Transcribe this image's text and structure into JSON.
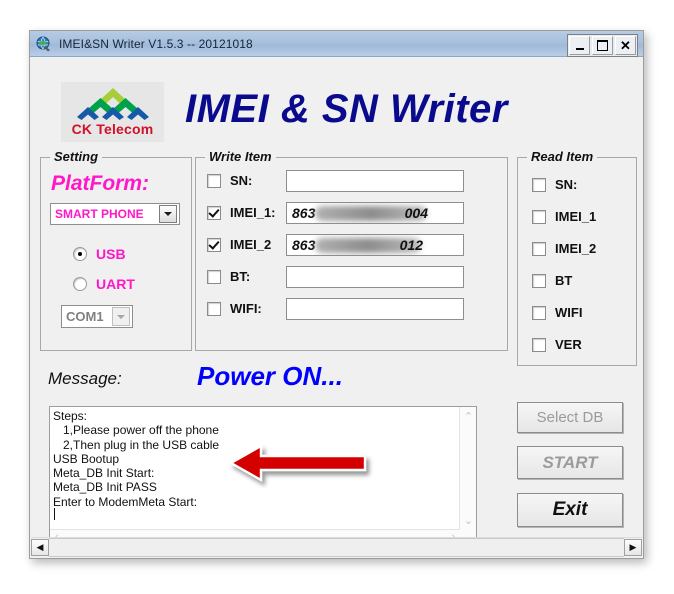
{
  "window": {
    "title": "IMEI&SN Writer V1.5.3 -- 20121018",
    "icon": "globe-icon",
    "minimize_label": "_",
    "maximize_label": "□",
    "close_label": "✕"
  },
  "header": {
    "logo_text": "CK Telecom",
    "app_title": "IMEI & SN Writer",
    "title_color": "#0a0a8c",
    "logo_color": "#d1102a"
  },
  "setting": {
    "group_title": "Setting",
    "platform_label": "PlatForm:",
    "platform_color": "#ff17c8",
    "platform_value": "SMART PHONE",
    "connection": [
      {
        "label": "USB",
        "selected": true
      },
      {
        "label": "UART",
        "selected": false
      }
    ],
    "port_value": "COM1",
    "port_enabled": false
  },
  "write_item": {
    "group_title": "Write Item",
    "rows": [
      {
        "label": "SN:",
        "checked": false,
        "value": "",
        "redacted": false
      },
      {
        "label": "IMEI_1:",
        "checked": true,
        "value": "863",
        "value_suffix": "004",
        "redacted": true
      },
      {
        "label": "IMEI_2",
        "checked": true,
        "value": "863",
        "value_suffix": "012",
        "redacted": true
      },
      {
        "label": "BT:",
        "checked": false,
        "value": "",
        "redacted": false
      },
      {
        "label": "WIFI:",
        "checked": false,
        "value": "",
        "redacted": false
      }
    ]
  },
  "read_item": {
    "group_title": "Read Item",
    "rows": [
      {
        "label": "SN:",
        "checked": false
      },
      {
        "label": "IMEI_1",
        "checked": false
      },
      {
        "label": "IMEI_2",
        "checked": false
      },
      {
        "label": "BT",
        "checked": false
      },
      {
        "label": "WIFI",
        "checked": false
      },
      {
        "label": "VER",
        "checked": false
      }
    ]
  },
  "message": {
    "label": "Message:",
    "status": "Power ON...",
    "status_color": "#0000ff",
    "log": "Steps:\n   1,Please power off the phone\n   2,Then plug in the USB cable\nUSB Bootup\nMeta_DB Init Start:\nMeta_DB Init PASS\nEnter to ModemMeta Start:",
    "scroll_up": "⌃",
    "scroll_down": "⌄",
    "scroll_left": "‹",
    "scroll_right": "›"
  },
  "annotation": {
    "arrow": "red-left-arrow",
    "arrow_color": "#d40000"
  },
  "buttons": {
    "select_db": {
      "label": "Select DB",
      "enabled": false
    },
    "start": {
      "label": "START",
      "enabled": false
    },
    "exit": {
      "label": "Exit",
      "enabled": true
    }
  },
  "window_scrollbar": {
    "left_arrow": "◀",
    "right_arrow": "▶"
  }
}
